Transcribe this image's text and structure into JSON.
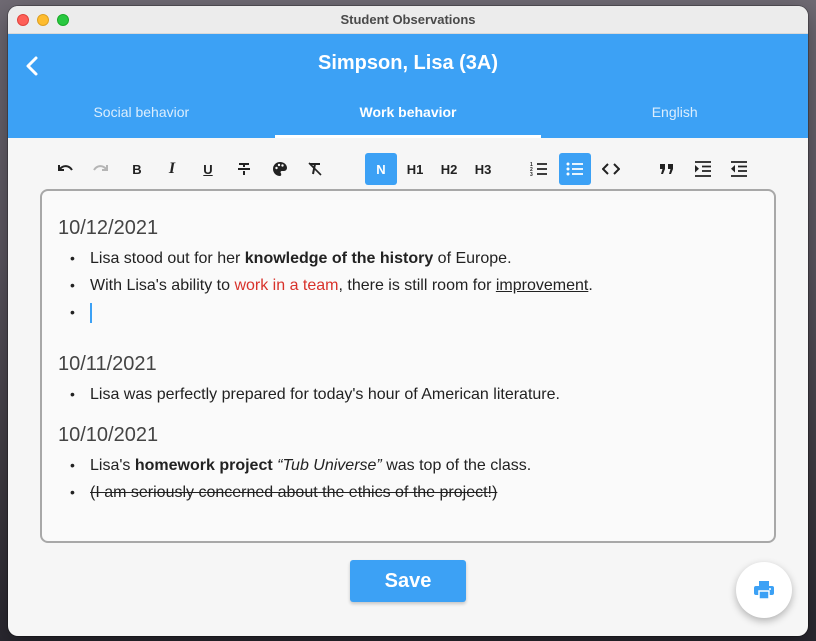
{
  "window": {
    "title": "Student Observations"
  },
  "header": {
    "student": "Simpson, Lisa (3A)",
    "back_icon": "chevron-left-icon"
  },
  "tabs": [
    {
      "label": "Social behavior",
      "active": false
    },
    {
      "label": "Work behavior",
      "active": true
    },
    {
      "label": "English",
      "active": false
    }
  ],
  "toolbar": {
    "undo_icon": "undo-icon",
    "redo_icon": "redo-icon",
    "bold": "B",
    "italic": "I",
    "underline": "U",
    "strikethrough_icon": "strikethrough-icon",
    "color_icon": "palette-icon",
    "clear_format_icon": "clear-format-icon",
    "normal": "N",
    "h1": "H1",
    "h2": "H2",
    "h3": "H3",
    "ordered_list_icon": "numbered-list-icon",
    "bullet_list_icon": "bullet-list-icon",
    "code_icon": "code-icon",
    "quote_icon": "quote-icon",
    "indent_icon": "indent-increase-icon",
    "outdent_icon": "indent-decrease-icon",
    "active": [
      "normal",
      "bullet_list"
    ]
  },
  "entries": [
    {
      "date": "10/12/2021",
      "items": [
        {
          "a": "Lisa stood out for her ",
          "b": "knowledge of the history",
          "c": " of Europe."
        },
        {
          "a": "With Lisa's ability to ",
          "red": "work in a team",
          "b": ", there is still room for ",
          "u": "improvement",
          "c": "."
        },
        {
          "empty": true
        }
      ]
    },
    {
      "date": "10/11/2021",
      "items": [
        {
          "a": "Lisa was perfectly prepared for today's hour of American literature."
        }
      ]
    },
    {
      "date": "10/10/2021",
      "items": [
        {
          "a": "Lisa's ",
          "b": "homework project",
          "i": "“Tub Universe”",
          "c": " was top of the class."
        },
        {
          "strike": "(I am seriously concerned about the ethics of the project!)"
        }
      ]
    }
  ],
  "actions": {
    "save": "Save",
    "print_icon": "print-icon"
  },
  "colors": {
    "accent": "#3ca1f5",
    "highlight_red": "#d8322b"
  }
}
